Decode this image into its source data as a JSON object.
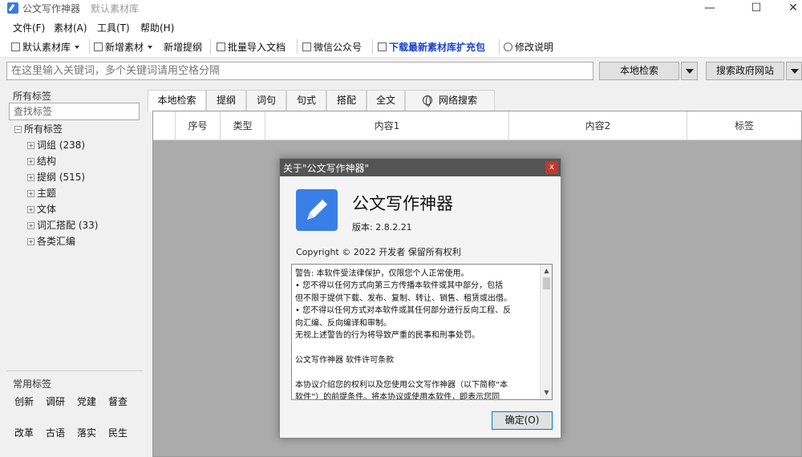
{
  "window": {
    "title": "公文写作神器",
    "subtitle": "默认素材库",
    "minimize": "—",
    "maximize": "☐",
    "close": "✕"
  },
  "menu": [
    "文件(F)",
    "素材(A)",
    "工具(T)",
    "帮助(H)"
  ],
  "toolbar": {
    "library": "默认素材库",
    "new_material": "新增素材",
    "new_outline": "新增提纲",
    "import_docs": "批量导入文档",
    "wechat": "微信公众号",
    "download": "下载最新素材库扩充包",
    "changelog": "修改说明",
    "download_color": "#1a44c8"
  },
  "search": {
    "placeholder": "在这里输入关键词，多个关键词请用空格分隔",
    "local_button": "本地检索",
    "gov_button": "搜索政府网站"
  },
  "left_panel": {
    "all_tags_label": "所有标签",
    "tag_search_placeholder": "查找标签",
    "tree_root": "所有标签",
    "tree_items": [
      "词组 (238)",
      "结构",
      "提纲 (515)",
      "主题",
      "文体",
      "词汇搭配 (33)",
      "各类汇编"
    ],
    "common_tags_label": "常用标签",
    "common_tags": [
      "创新",
      "调研",
      "党建",
      "督查",
      "改革",
      "古语",
      "落实",
      "民生"
    ]
  },
  "tabs": [
    "本地检索",
    "提纲",
    "词句",
    "句式",
    "搭配",
    "全文",
    "网络搜索"
  ],
  "grid_headers": [
    "序号",
    "类型",
    "内容1",
    "内容2",
    "标签"
  ],
  "dialog": {
    "title": "关于\"公文写作神器\"",
    "close": "x",
    "app_name": "公文写作神器",
    "version": "版本: 2.8.2.21",
    "copyright": "Copyright © 2022  开发者 保留所有权利",
    "license_lines": [
      "警告: 本软件受法律保护，仅限您个人正常使用。",
      "• 您不得以任何方式向第三方传播本软件或其中部分，包括",
      "但不限于提供下载、发布、复制、转让、销售、租赁或出借。",
      "• 您不得以任何方式对本软件或其任何部分进行反向工程、反",
      "向汇编、反向编译和审制。",
      "无视上述警告的行为将导致严重的民事和刑事处罚。",
      "",
      "公文写作神器 软件许可条款",
      "",
      "本协议介绍您的权利以及您使用公文写作神器（以下简称“本",
      "软件”）的前提条件。将本协议或使用本软件，即表示您同"
    ],
    "ok_button": "确定(O)"
  }
}
